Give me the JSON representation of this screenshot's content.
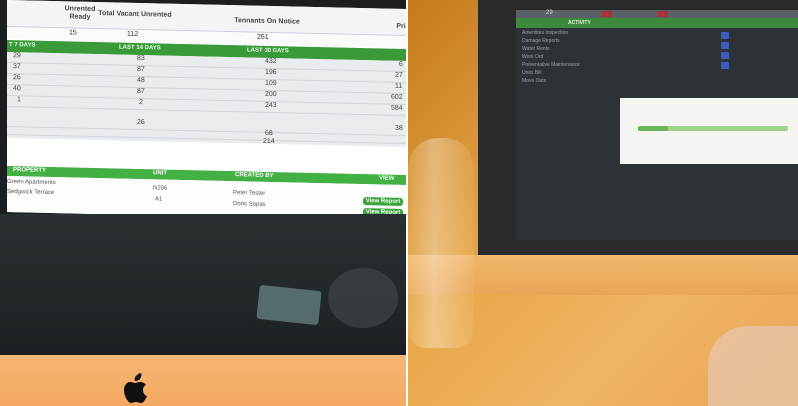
{
  "left_screen": {
    "headers": {
      "unrented_ready": "Unrented Ready",
      "total_vacant_unrented": "Total Vacant Unrented",
      "tenants_on_notice": "Tennants On Notice",
      "pri": "Pri"
    },
    "counts": {
      "unrented_ready": "15",
      "total_vacant_unrented": "112",
      "tenants_on_notice": "261"
    },
    "period_headers": {
      "last_7": "T 7 DAYS",
      "last_14": "LAST 14 DAYS",
      "last_30": "LAST 30 DAYS"
    },
    "rows": [
      {
        "c1": "29",
        "c2": "83",
        "c3": "432",
        "c4": "6"
      },
      {
        "c1": "37",
        "c2": "87",
        "c3": "196",
        "c4": "27"
      },
      {
        "c1": "26",
        "c2": "48",
        "c3": "109",
        "c4": "11"
      },
      {
        "c1": "40",
        "c2": "87",
        "c3": "200",
        "c4": "602"
      },
      {
        "c1": "1",
        "c2": "2",
        "c3": "243",
        "c4": "584"
      },
      {
        "c1": "",
        "c2": "26",
        "c3": "",
        "c4": "38"
      },
      {
        "c1": "",
        "c2": "",
        "c3": "68",
        "c4": ""
      },
      {
        "c1": "",
        "c2": "",
        "c3": "214",
        "c4": ""
      }
    ],
    "property_table": {
      "headers": {
        "property": "PROPERTY",
        "unit": "UNIT",
        "created_by": "CREATED BY",
        "view": "VIEW"
      },
      "rows": [
        {
          "property": "Green Apartments",
          "unit": "N206",
          "created_by": "Peter Tester",
          "view": "View Report"
        },
        {
          "property": "Sedgwick Terrace",
          "unit": "A1",
          "created_by": "Doris Sopas",
          "view": "View Report"
        }
      ]
    }
  },
  "right_screen": {
    "top_value": "29",
    "headers": {
      "activity": "ACTIVITY"
    },
    "activity_items": [
      "Amenities Inspection",
      "Damage Reports",
      "Water Rents",
      "Work Ord",
      "Preventative Maintenance",
      "Units Bill",
      "Move Outs"
    ]
  },
  "colors": {
    "green_header": "#43b043",
    "button_green": "#3aa33a",
    "monitor_chin": "#f4a860",
    "ambient_orange": "#e8a94a"
  }
}
